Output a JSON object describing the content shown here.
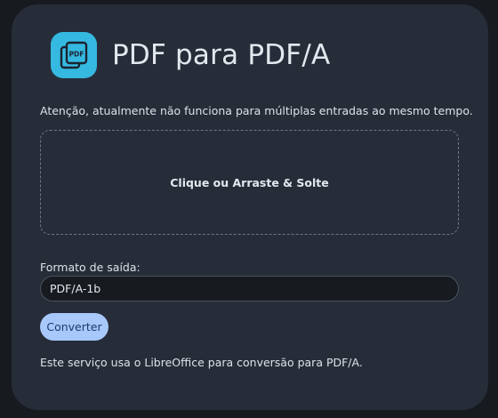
{
  "header": {
    "icon": "pdf-document-icon",
    "icon_text": "PDF",
    "title": "PDF para PDF/A"
  },
  "warning": "Atenção, atualmente não funciona para múltiplas entradas ao mesmo tempo.",
  "dropzone": {
    "label": "Clique ou Arraste & Solte"
  },
  "output_format": {
    "label": "Formato de saída:",
    "selected": "PDF/A-1b"
  },
  "convert_button": {
    "label": "Converter"
  },
  "footer_note": "Este serviço usa o LibreOffice para conversão para PDF/A.",
  "colors": {
    "card_background": "#262d39",
    "icon_background": "#35b9e0",
    "button_background": "#a8c8fb"
  }
}
